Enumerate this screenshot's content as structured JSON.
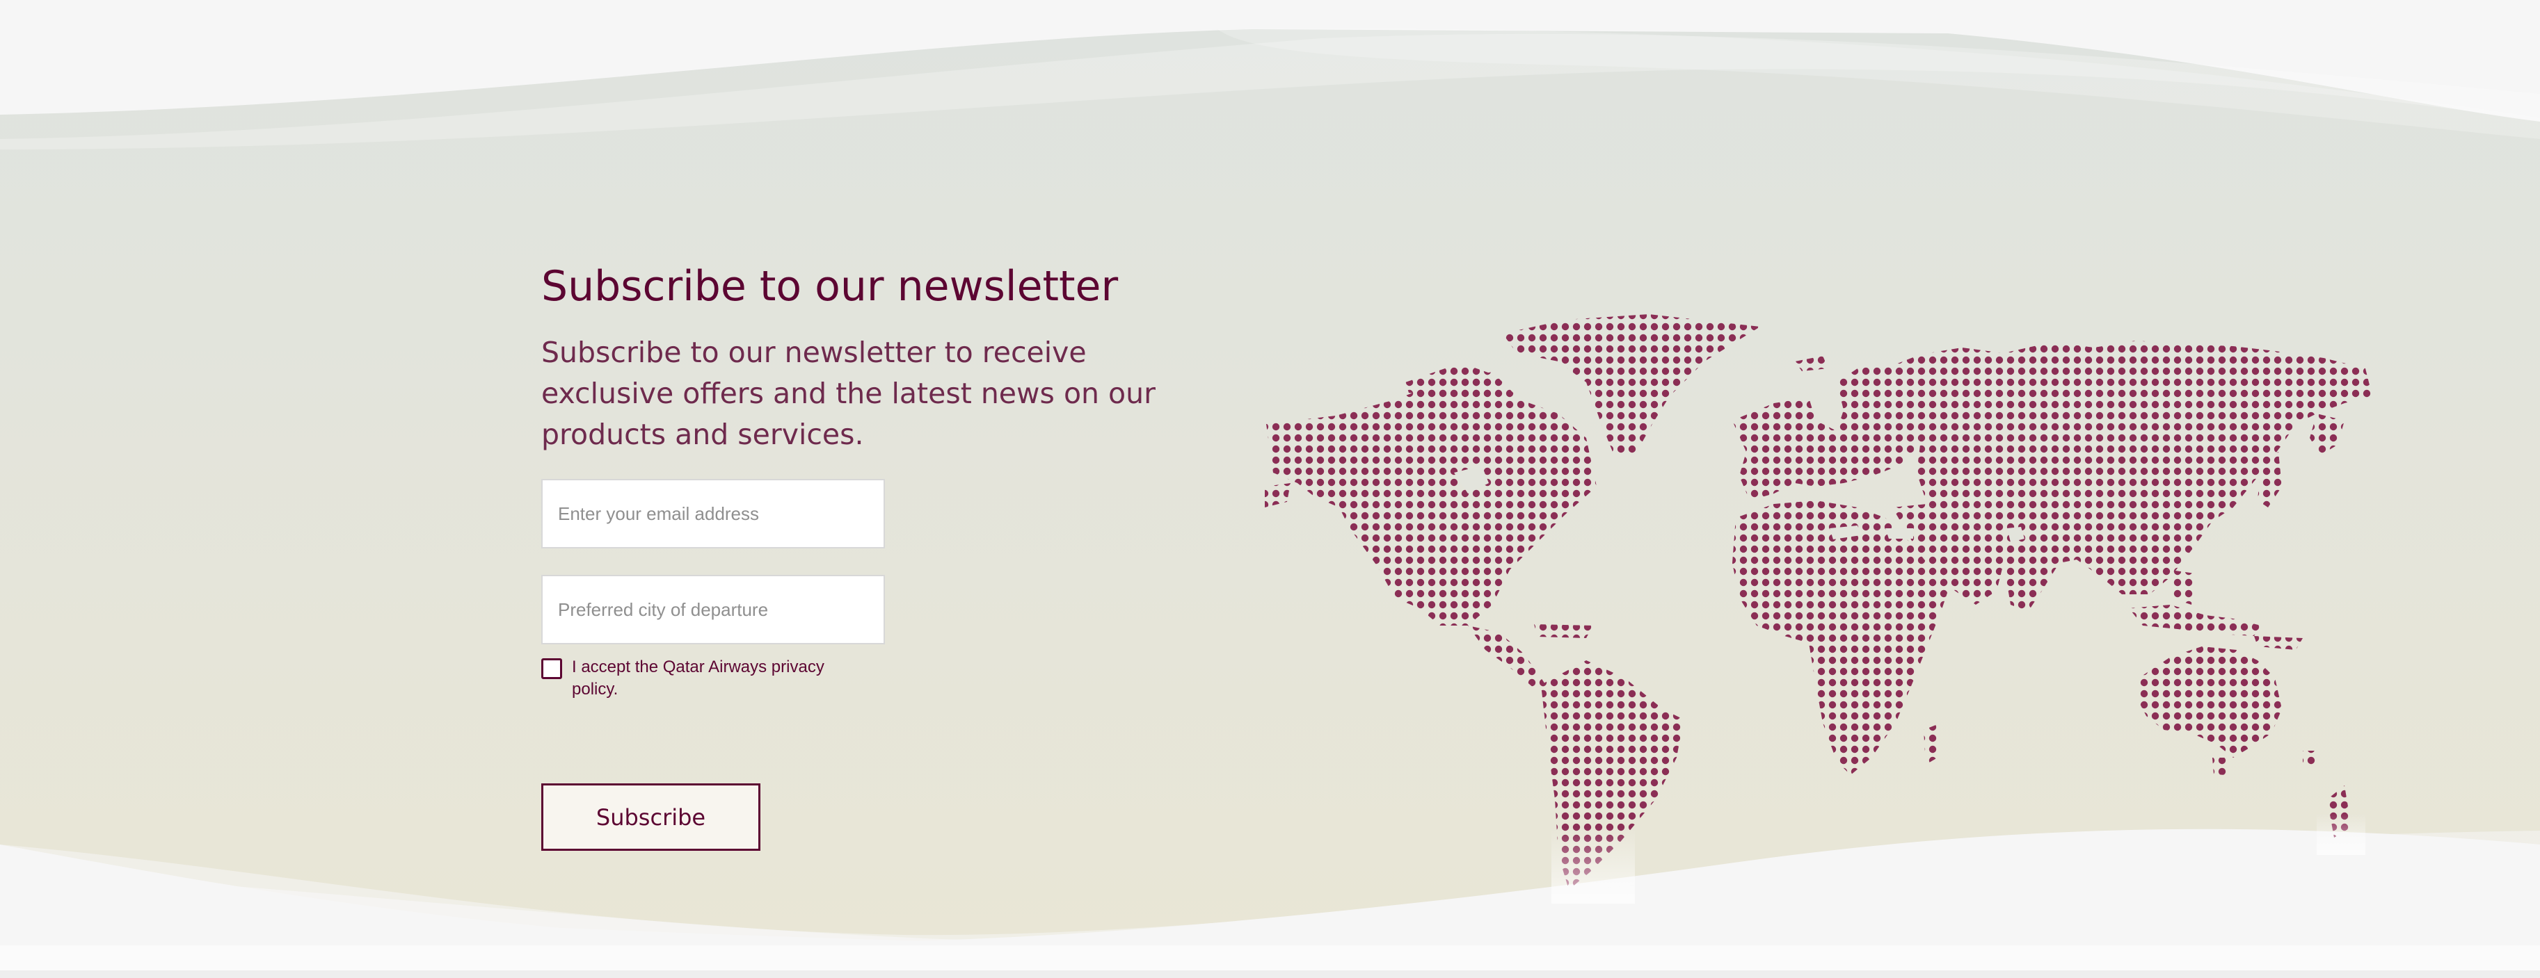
{
  "newsletter": {
    "title": "Subscribe to our newsletter",
    "description": "Subscribe to our newsletter to receive exclusive offers and the latest news on our products and services.",
    "email_placeholder": "Enter your email address",
    "city_placeholder": "Preferred city of departure",
    "privacy_label": "I accept the Qatar Airways privacy policy.",
    "privacy_checked": false,
    "subscribe_label": "Subscribe"
  },
  "map": {
    "icon": "world-map-dots"
  },
  "colors": {
    "brand": "#5c0632",
    "text_light": "#6e2a4d",
    "map_dot": "#8b2e55",
    "band_top": "#dfe3df",
    "band_bottom": "#e9e6d6"
  }
}
